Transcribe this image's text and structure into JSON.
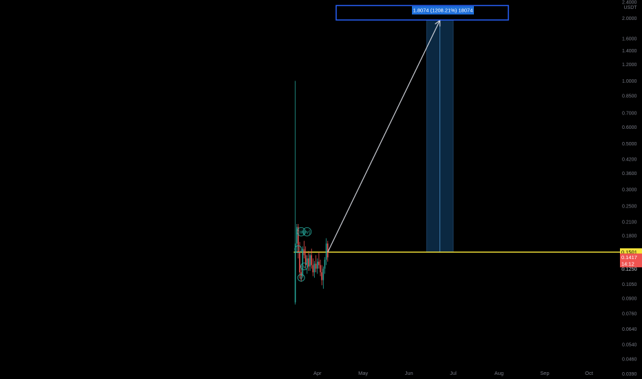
{
  "chart_data": {
    "type": "candlestick",
    "scale": "log",
    "currency_label": "USDT",
    "ylim": [
      0.0368,
      2.45
    ],
    "x_ticks": [
      {
        "label": "Apr",
        "value": 30
      },
      {
        "label": "May",
        "value": 61
      },
      {
        "label": "Jun",
        "value": 92
      },
      {
        "label": "Jul",
        "value": 122
      },
      {
        "label": "Aug",
        "value": 153
      },
      {
        "label": "Sep",
        "value": 184
      },
      {
        "label": "Oct",
        "value": 214
      }
    ],
    "xlim": [
      -185,
      234
    ],
    "y_ticks": [
      "2.4000",
      "2.0000",
      "1.6000",
      "1.4000",
      "1.2000",
      "1.0000",
      "0.8500",
      "0.7000",
      "0.6000",
      "0.5000",
      "0.4200",
      "0.3600",
      "0.3000",
      "0.2500",
      "0.2100",
      "0.1800",
      "0.1250",
      "0.1050",
      "0.0900",
      "0.0760",
      "0.0640",
      "0.0540",
      "0.0460",
      "0.0390"
    ],
    "candles": [
      {
        "day": 15,
        "open": 0.086,
        "high": 1.0,
        "low": 0.084,
        "close": 0.165
      },
      {
        "day": 16,
        "open": 0.165,
        "high": 0.205,
        "low": 0.15,
        "close": 0.198
      },
      {
        "day": 17,
        "open": 0.198,
        "high": 0.205,
        "low": 0.14,
        "close": 0.15
      },
      {
        "day": 18,
        "open": 0.15,
        "high": 0.168,
        "low": 0.112,
        "close": 0.12
      },
      {
        "day": 19,
        "open": 0.12,
        "high": 0.13,
        "low": 0.108,
        "close": 0.115
      },
      {
        "day": 20,
        "open": 0.115,
        "high": 0.16,
        "low": 0.113,
        "close": 0.155
      },
      {
        "day": 21,
        "open": 0.155,
        "high": 0.17,
        "low": 0.14,
        "close": 0.145
      },
      {
        "day": 22,
        "open": 0.145,
        "high": 0.16,
        "low": 0.125,
        "close": 0.13
      },
      {
        "day": 23,
        "open": 0.13,
        "high": 0.145,
        "low": 0.118,
        "close": 0.14
      },
      {
        "day": 24,
        "open": 0.14,
        "high": 0.152,
        "low": 0.122,
        "close": 0.128
      },
      {
        "day": 25,
        "open": 0.128,
        "high": 0.148,
        "low": 0.122,
        "close": 0.145
      },
      {
        "day": 26,
        "open": 0.145,
        "high": 0.156,
        "low": 0.125,
        "close": 0.13
      },
      {
        "day": 27,
        "open": 0.13,
        "high": 0.14,
        "low": 0.115,
        "close": 0.12
      },
      {
        "day": 28,
        "open": 0.12,
        "high": 0.136,
        "low": 0.113,
        "close": 0.132
      },
      {
        "day": 29,
        "open": 0.132,
        "high": 0.145,
        "low": 0.12,
        "close": 0.125
      },
      {
        "day": 30,
        "open": 0.125,
        "high": 0.14,
        "low": 0.118,
        "close": 0.135
      },
      {
        "day": 31,
        "open": 0.135,
        "high": 0.15,
        "low": 0.125,
        "close": 0.13
      },
      {
        "day": 32,
        "open": 0.13,
        "high": 0.138,
        "low": 0.115,
        "close": 0.12
      },
      {
        "day": 33,
        "open": 0.12,
        "high": 0.13,
        "low": 0.104,
        "close": 0.11
      },
      {
        "day": 34,
        "open": 0.11,
        "high": 0.128,
        "low": 0.1,
        "close": 0.125
      },
      {
        "day": 35,
        "open": 0.125,
        "high": 0.142,
        "low": 0.118,
        "close": 0.138
      },
      {
        "day": 36,
        "open": 0.138,
        "high": 0.175,
        "low": 0.13,
        "close": 0.165
      },
      {
        "day": 37,
        "open": 0.165,
        "high": 0.17,
        "low": 0.135,
        "close": 0.1417
      }
    ],
    "wave_labels": [
      {
        "text": "(iii)",
        "day": 19,
        "price": 0.188
      },
      {
        "text": "(iv)",
        "day": 23,
        "price": 0.188
      },
      {
        "text": "i",
        "day": 17,
        "price": 0.155
      },
      {
        "text": "iv",
        "day": 21,
        "price": 0.128
      },
      {
        "text": "ii",
        "day": 19,
        "price": 0.113
      }
    ],
    "horizontal_line": {
      "price": 0.1501,
      "from_day": 14,
      "label": "0.1501"
    },
    "current_price": {
      "value": "0.1417",
      "countdown": "14:12",
      "price": 0.1417
    },
    "hidden_price_label": "0.1250",
    "target_arrow": {
      "from_day": 37,
      "from_price": 0.1501,
      "to_day": 113,
      "to_price": 1.9575
    },
    "projection_box": {
      "from_day": 104,
      "to_day": 122,
      "low": 0.1501,
      "high": 1.9575
    },
    "measure_label": {
      "text": "1.8074 (1208.21%) 18074"
    },
    "colors": {
      "up": "#26a69a",
      "down": "#ef5350",
      "horizontal_line": "#f5e43a",
      "current_price": "#ef5350",
      "projection_fill": "#0c2a44",
      "projection_border": "#2962ff",
      "measure_bg": "#1e6fd9",
      "wave_label": "#26a69a",
      "arrow": "#d1d4dc",
      "axis_text": "#787b86"
    }
  }
}
